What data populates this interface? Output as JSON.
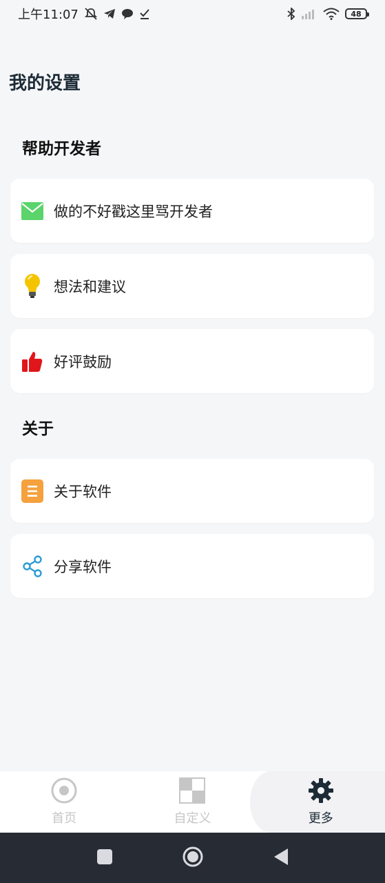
{
  "status_bar": {
    "time": "上午11:07",
    "battery": "48"
  },
  "page": {
    "title": "我的设置"
  },
  "sections": [
    {
      "title": "帮助开发者",
      "items": [
        {
          "label": "做的不好戳这里骂开发者",
          "icon": "mail-icon",
          "color": "#5ad46b"
        },
        {
          "label": "想法和建议",
          "icon": "lightbulb-icon",
          "color": "#f5c400"
        },
        {
          "label": "好评鼓励",
          "icon": "thumbs-up-icon",
          "color": "#e0161b"
        }
      ]
    },
    {
      "title": "关于",
      "items": [
        {
          "label": "关于软件",
          "icon": "document-icon",
          "color": "#f5a13d"
        },
        {
          "label": "分享软件",
          "icon": "share-icon",
          "color": "#2a9bd4"
        }
      ]
    }
  ],
  "bottom_nav": {
    "items": [
      {
        "label": "首页",
        "icon": "target-icon",
        "active": false
      },
      {
        "label": "自定义",
        "icon": "grid-icon",
        "active": false
      },
      {
        "label": "更多",
        "icon": "gear-icon",
        "active": true
      }
    ]
  },
  "colors": {
    "background": "#f5f6f8",
    "card": "#ffffff",
    "accent_dark": "#1c2b36",
    "system_nav": "#272b34"
  }
}
